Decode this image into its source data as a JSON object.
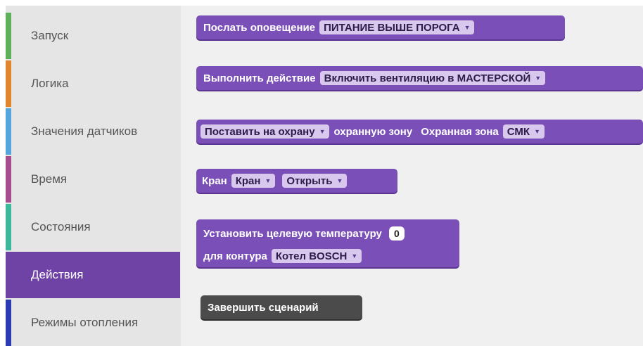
{
  "sidebar": {
    "categories": [
      {
        "label": "Запуск",
        "color": "#5fb05a"
      },
      {
        "label": "Логика",
        "color": "#e0872d"
      },
      {
        "label": "Значения датчиков",
        "color": "#55a6dd"
      },
      {
        "label": "Время",
        "color": "#a54d8f"
      },
      {
        "label": "Состояния",
        "color": "#3cb89b"
      },
      {
        "label": "Действия",
        "color": "#6f42a6"
      },
      {
        "label": "Режимы отопления",
        "color": "#2b3bb0"
      }
    ],
    "selected_index": 5
  },
  "blocks": {
    "notify": {
      "label": "Послать оповещение",
      "dropdown": "ПИТАНИЕ ВЫШЕ ПОРОГА"
    },
    "action": {
      "label": "Выполнить действие",
      "dropdown": "Включить вентиляцию в МАСТЕРСКОЙ"
    },
    "security": {
      "mode_dropdown": "Поставить на охрану",
      "zone_text": "охранную зону",
      "zone_label": "Охранная зона",
      "zone_dropdown": "СМК"
    },
    "valve": {
      "label": "Кран",
      "valve_dropdown": "Кран",
      "state_dropdown": "Открыть"
    },
    "temperature": {
      "label": "Установить целевую температуру",
      "value": "0",
      "circuit_label": "для контура",
      "circuit_dropdown": "Котел BOSCH"
    },
    "finish": {
      "label": "Завершить сценарий"
    }
  },
  "colors": {
    "block_purple": "#7b4fb8",
    "block_dark": "#4b4b4b",
    "selected_category": "#6f42a6"
  },
  "icons": {
    "dropdown_arrow": "▾"
  }
}
